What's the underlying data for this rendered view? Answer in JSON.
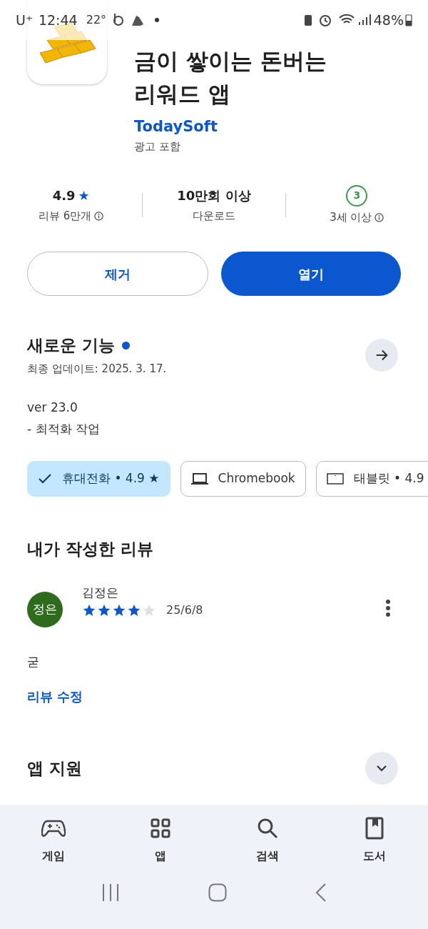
{
  "status_bar": {
    "carrier": "U⁺",
    "time": "12:44",
    "temperature": "22°",
    "battery": "48%"
  },
  "app": {
    "title_lines": [
      "금이 쌓이는 돈버는",
      "리워드 앱"
    ],
    "developer": "TodaySoft",
    "ads_note": "광고 포함"
  },
  "stats": [
    {
      "kind": "rating",
      "value": "4.9",
      "star": "★",
      "label": "리뷰 6만개",
      "info": true
    },
    {
      "kind": "text",
      "value": "10만회 이상",
      "label": "다운로드"
    },
    {
      "kind": "age",
      "value": "3",
      "label": "3세 이상",
      "info": true
    }
  ],
  "buttons": [
    {
      "label": "제거",
      "kind": "outline"
    },
    {
      "label": "열기",
      "kind": "filled"
    }
  ],
  "whats_new": {
    "title": "새로운 기능",
    "updated": "최종 업데이트: 2025. 3. 17.",
    "notes": [
      "ver 23.0",
      "- 최적화 작업"
    ]
  },
  "device_chips": [
    {
      "label": "휴대전화 • 4.9 ★",
      "selected": true
    },
    {
      "label": "Chromebook",
      "kind": "laptop",
      "selected": false
    },
    {
      "label": "태블릿 • 4.9",
      "kind": "tablet",
      "selected": false
    }
  ],
  "my_review": {
    "title": "내가 작성한 리뷰",
    "avatar": "정은",
    "author": "김정은",
    "stars": 4,
    "date": "25/6/8",
    "text": "굳",
    "edit_link": "리뷰 수정"
  },
  "app_support": {
    "title": "앱 지원",
    "expanded": false
  },
  "bottom_nav": [
    {
      "label": "게임",
      "kind": "games"
    },
    {
      "label": "앱",
      "kind": "apps"
    },
    {
      "label": "검색",
      "kind": "search"
    },
    {
      "label": "도서",
      "kind": "books"
    }
  ]
}
